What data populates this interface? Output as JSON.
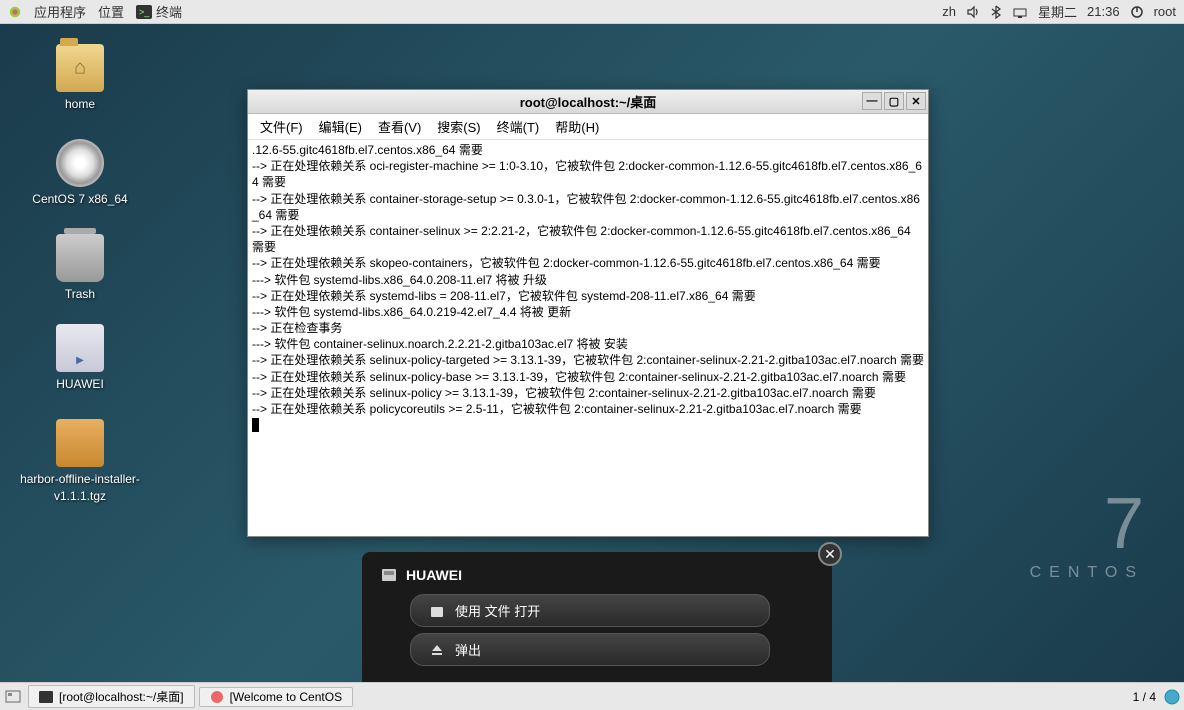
{
  "topbar": {
    "apps": "应用程序",
    "places": "位置",
    "terminal_tab": "终端",
    "lang": "zh",
    "day": "星期二",
    "time": "21:36",
    "user": "root"
  },
  "desktop_icons": {
    "home": "home",
    "centos": "CentOS 7 x86_64",
    "trash": "Trash",
    "huawei": "HUAWEI",
    "harbor": "harbor-offline-installer-v1.1.1.tgz"
  },
  "centos_brand": {
    "num": "7",
    "name": "CENTOS"
  },
  "terminal": {
    "title": "root@localhost:~/桌面",
    "menu": {
      "file": "文件(F)",
      "edit": "编辑(E)",
      "view": "查看(V)",
      "search": "搜索(S)",
      "terminal": "终端(T)",
      "help": "帮助(H)"
    },
    "output": ".12.6-55.gitc4618fb.el7.centos.x86_64 需要\n--> 正在处理依赖关系 oci-register-machine >= 1:0-3.10，它被软件包 2:docker-common-1.12.6-55.gitc4618fb.el7.centos.x86_64 需要\n--> 正在处理依赖关系 container-storage-setup >= 0.3.0-1，它被软件包 2:docker-common-1.12.6-55.gitc4618fb.el7.centos.x86_64 需要\n--> 正在处理依赖关系 container-selinux >= 2:2.21-2，它被软件包 2:docker-common-1.12.6-55.gitc4618fb.el7.centos.x86_64 需要\n--> 正在处理依赖关系 skopeo-containers，它被软件包 2:docker-common-1.12.6-55.gitc4618fb.el7.centos.x86_64 需要\n---> 软件包 systemd-libs.x86_64.0.208-11.el7 将被 升级\n--> 正在处理依赖关系 systemd-libs = 208-11.el7，它被软件包 systemd-208-11.el7.x86_64 需要\n---> 软件包 systemd-libs.x86_64.0.219-42.el7_4.4 将被 更新\n--> 正在检查事务\n---> 软件包 container-selinux.noarch.2.2.21-2.gitba103ac.el7 将被 安装\n--> 正在处理依赖关系 selinux-policy-targeted >= 3.13.1-39，它被软件包 2:container-selinux-2.21-2.gitba103ac.el7.noarch 需要\n--> 正在处理依赖关系 selinux-policy-base >= 3.13.1-39，它被软件包 2:container-selinux-2.21-2.gitba103ac.el7.noarch 需要\n--> 正在处理依赖关系 selinux-policy >= 3.13.1-39，它被软件包 2:container-selinux-2.21-2.gitba103ac.el7.noarch 需要\n--> 正在处理依赖关系 policycoreutils >= 2.5-11，它被软件包 2:container-selinux-2.21-2.gitba103ac.el7.noarch 需要"
  },
  "notification": {
    "title": "HUAWEI",
    "open_files": "使用 文件 打开",
    "eject": "弹出"
  },
  "bottombar": {
    "task1": "[root@localhost:~/桌面]",
    "task2": "[Welcome to CentOS",
    "workspace": "1 / 4"
  }
}
